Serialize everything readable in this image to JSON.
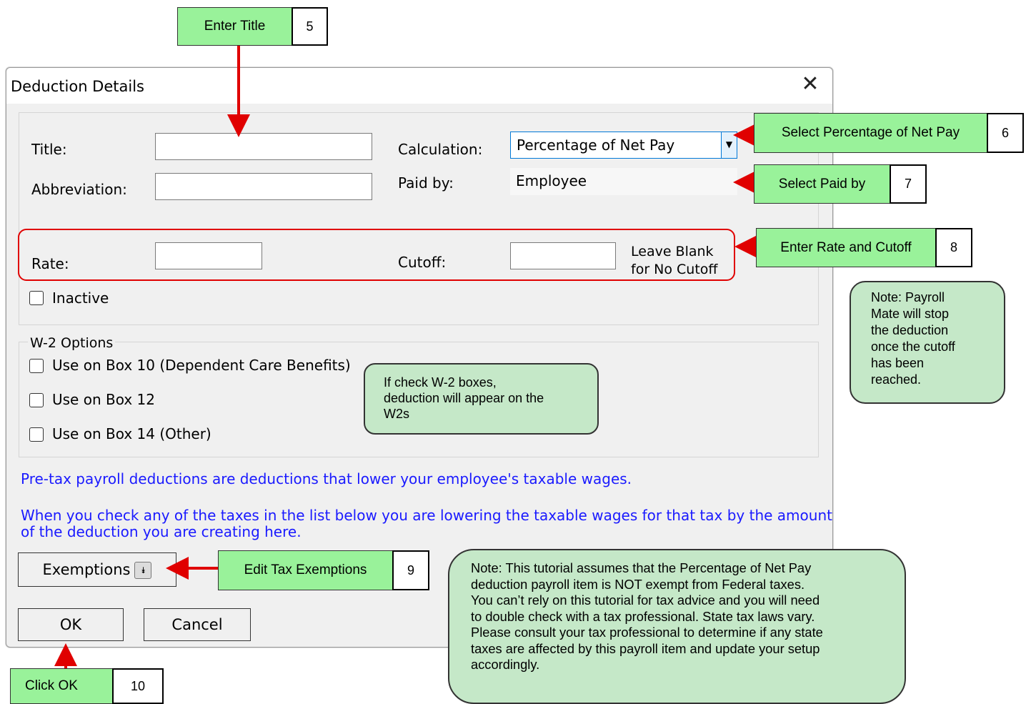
{
  "dialog": {
    "title": "Deduction Details",
    "close_glyph": "✕",
    "fields": {
      "title_label": "Title:",
      "title_value": "",
      "abbreviation_label": "Abbreviation:",
      "abbreviation_value": "",
      "calculation_label": "Calculation:",
      "calculation_value": "Percentage of Net Pay",
      "paid_by_label": "Paid by:",
      "paid_by_value": "Employee",
      "rate_label": "Rate:",
      "rate_value": "",
      "cutoff_label": "Cutoff:",
      "cutoff_value": "",
      "cutoff_hint_line1": "Leave Blank",
      "cutoff_hint_line2": "for No Cutoff",
      "inactive_label": "Inactive"
    },
    "w2": {
      "group_label": "W-2 Options",
      "options": [
        {
          "label": "Use on Box 10 (Dependent Care Benefits)",
          "checked": false
        },
        {
          "label": "Use on Box 12",
          "checked": false
        },
        {
          "label": "Use on Box 14 (Other)",
          "checked": false
        }
      ]
    },
    "info_line1": "Pre-tax payroll deductions are deductions that lower your employee's taxable wages.",
    "info_line2a": "When you check any of the taxes in the list below you are lowering the taxable wages for that tax by the amount",
    "info_line2b": "of the deduction you are creating here.",
    "buttons": {
      "exemptions": "Exemptions",
      "ok": "OK",
      "cancel": "Cancel"
    }
  },
  "annotations": {
    "step5": {
      "label": "Enter Title",
      "num": "5"
    },
    "step6": {
      "label": "Select Percentage of Net Pay",
      "num": "6"
    },
    "step7": {
      "label": "Select Paid by",
      "num": "7"
    },
    "step8": {
      "label": "Enter Rate and Cutoff",
      "num": "8"
    },
    "step9": {
      "label": "Edit Tax Exemptions",
      "num": "9"
    },
    "step10": {
      "label": "Click OK",
      "num": "10"
    },
    "note_cutoff": [
      "Note: Payroll",
      "Mate will stop",
      "the deduction",
      "once the cutoff",
      "has been",
      "reached."
    ],
    "note_w2": [
      "If check W-2 boxes,",
      "deduction will appear on the",
      "W2s"
    ],
    "note_tax": [
      "Note: This tutorial assumes that the Percentage of Net Pay",
      "deduction payroll item is NOT exempt from Federal taxes.",
      "You can’t rely on this tutorial for tax advice and you will need",
      "to double check with a tax professional. State tax laws vary.",
      "Please consult your tax professional to determine if any state",
      "taxes are affected by this payroll item and update your setup",
      "accordingly."
    ]
  },
  "colors": {
    "callout_green": "#99f29a",
    "note_green": "#c5e8c8",
    "arrow_red": "#e00000",
    "info_blue": "#1a1aff"
  }
}
